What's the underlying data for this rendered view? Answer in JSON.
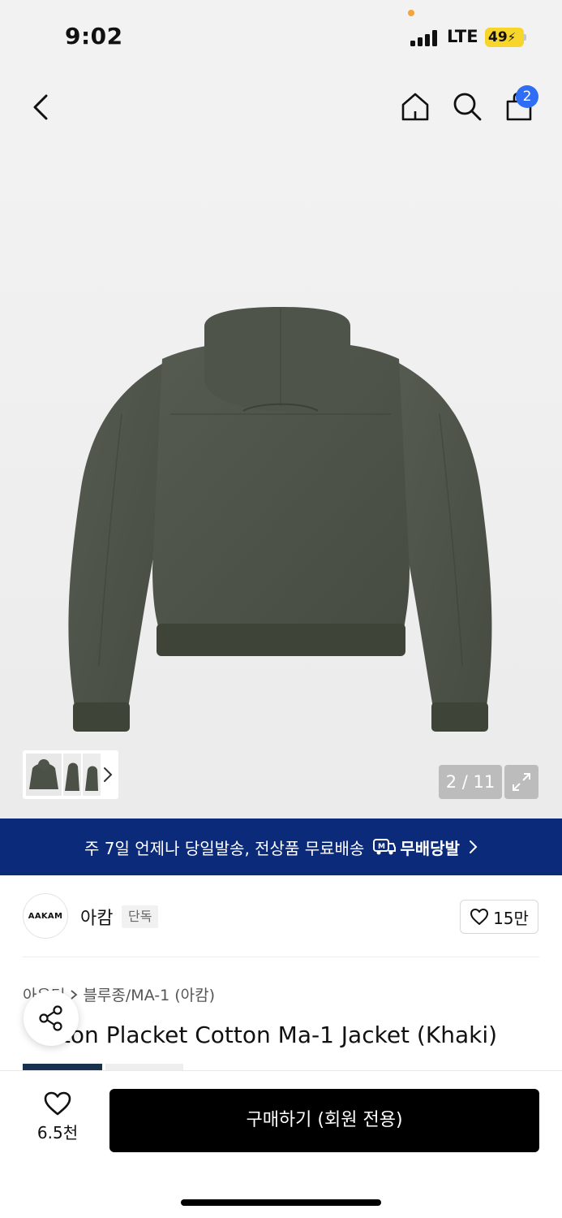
{
  "status": {
    "time": "9:02",
    "network": "LTE",
    "battery": "49"
  },
  "header": {
    "cart_count": "2"
  },
  "gallery": {
    "pager": "2 / 11"
  },
  "promo": {
    "text": "주 7일 언제나 당일발송, 전상품 무료배송",
    "brand": "무배당발"
  },
  "brand": {
    "logo_text": "AAKAM",
    "name": "아캄",
    "tag": "단독",
    "likes": "15만"
  },
  "product": {
    "breadcrumb": [
      "아우터",
      "블루종/MA-1 (아캄)"
    ],
    "title_visible": "Button Placket Cotton Ma-1 Jacket (Khaki)",
    "title_partial": "tton Placket Cotton Ma-1 Jacket (Khaki)"
  },
  "bottom": {
    "wish_count": "6.5천",
    "buy_label": "구매하기 (회원 전용)"
  },
  "colors": {
    "promo_bg": "#0b2a7a",
    "badge_blue": "#2f6df5",
    "battery_yellow": "#f7d52a",
    "jacket_khaki": "#4b5146"
  }
}
